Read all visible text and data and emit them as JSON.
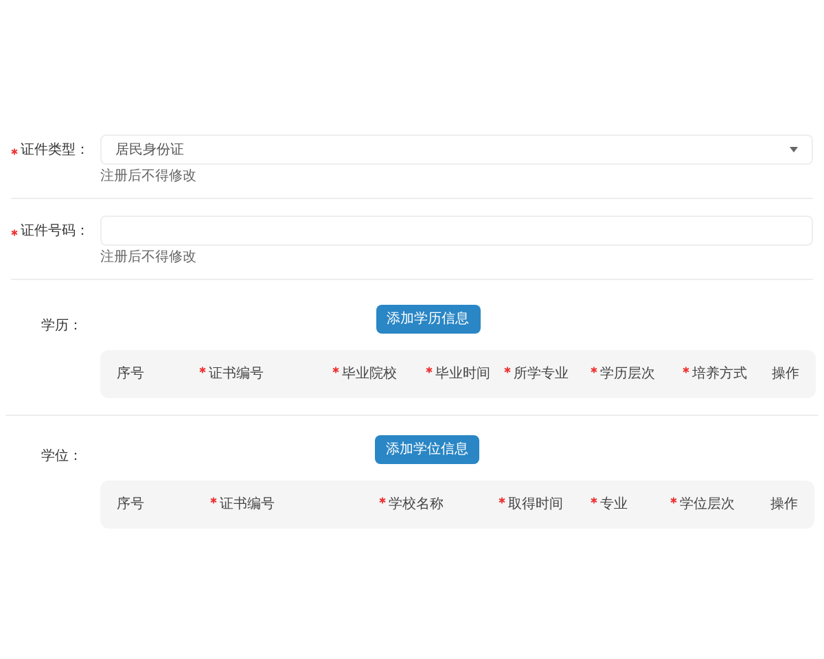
{
  "fields": [
    {
      "label": "证件类型：",
      "required": true,
      "kind": "select",
      "value": "居民身份证",
      "hint": "注册后不得修改"
    },
    {
      "label": "证件号码：",
      "required": true,
      "kind": "input",
      "hint": "注册后不得修改"
    }
  ],
  "sections": [
    {
      "label": "学历：",
      "button": "添加学历信息",
      "columns": [
        {
          "label": "序号",
          "required": false
        },
        {
          "label": "证书编号",
          "required": true
        },
        {
          "label": "毕业院校",
          "required": true
        },
        {
          "label": "毕业时间",
          "required": true
        },
        {
          "label": "所学专业",
          "required": true
        },
        {
          "label": "学历层次",
          "required": true
        },
        {
          "label": "培养方式",
          "required": true
        },
        {
          "label": "操作",
          "required": false
        }
      ]
    },
    {
      "label": "学位：",
      "button": "添加学位信息",
      "columns": [
        {
          "label": "序号",
          "required": false
        },
        {
          "label": "证书编号",
          "required": true
        },
        {
          "label": "学校名称",
          "required": true
        },
        {
          "label": "取得时间",
          "required": true
        },
        {
          "label": "专业",
          "required": true
        },
        {
          "label": "学位层次",
          "required": true
        },
        {
          "label": "操作",
          "required": false
        }
      ]
    }
  ]
}
